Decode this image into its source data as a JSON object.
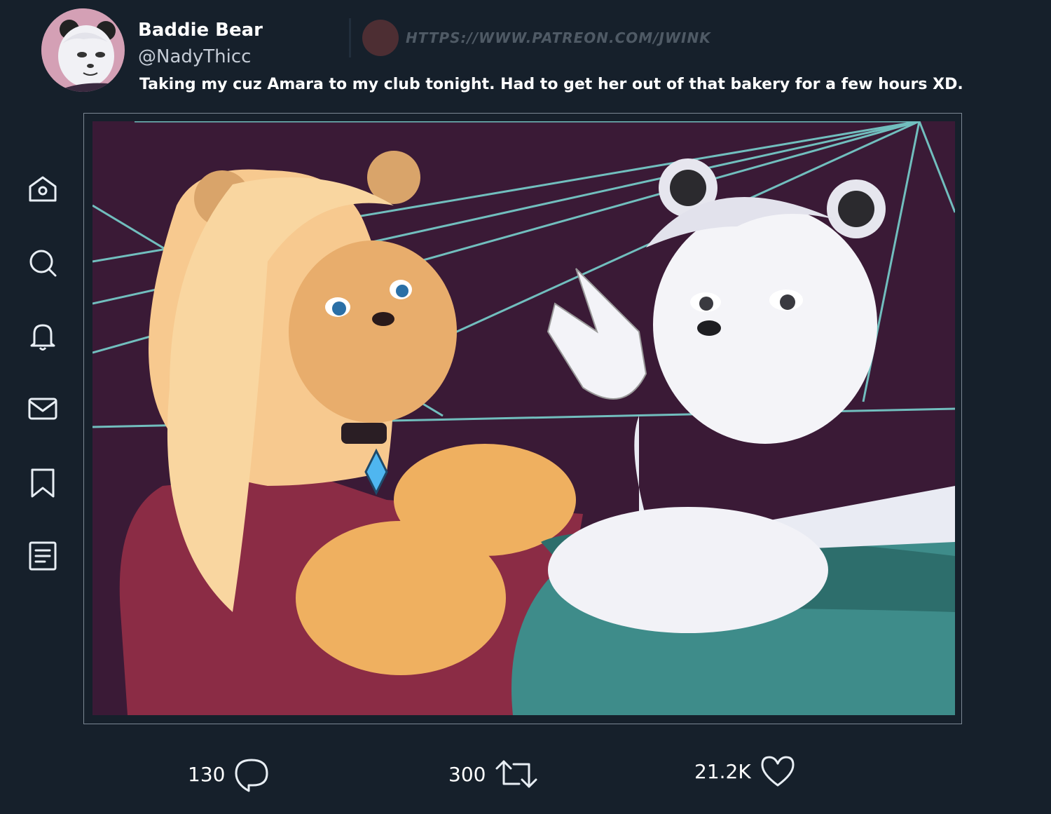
{
  "post": {
    "display_name": "Baddie Bear",
    "handle": "@NadyThicc",
    "text": "Taking my cuz Amara to my club tonight. Had to get her out of that bakery for a few hours XD.",
    "watermark": "HTTPS://WWW.PATREON.COM/JWINK"
  },
  "sidebar": {
    "items": [
      {
        "icon": "home-icon"
      },
      {
        "icon": "search-icon"
      },
      {
        "icon": "bell-icon"
      },
      {
        "icon": "mail-icon"
      },
      {
        "icon": "bookmark-icon"
      },
      {
        "icon": "list-icon"
      }
    ]
  },
  "actions": {
    "replies": "130",
    "retweets": "300",
    "likes": "21.2K"
  },
  "colors": {
    "background": "#16202b",
    "text": "#ffffff",
    "avatar_bg": "#d4a0b5"
  }
}
